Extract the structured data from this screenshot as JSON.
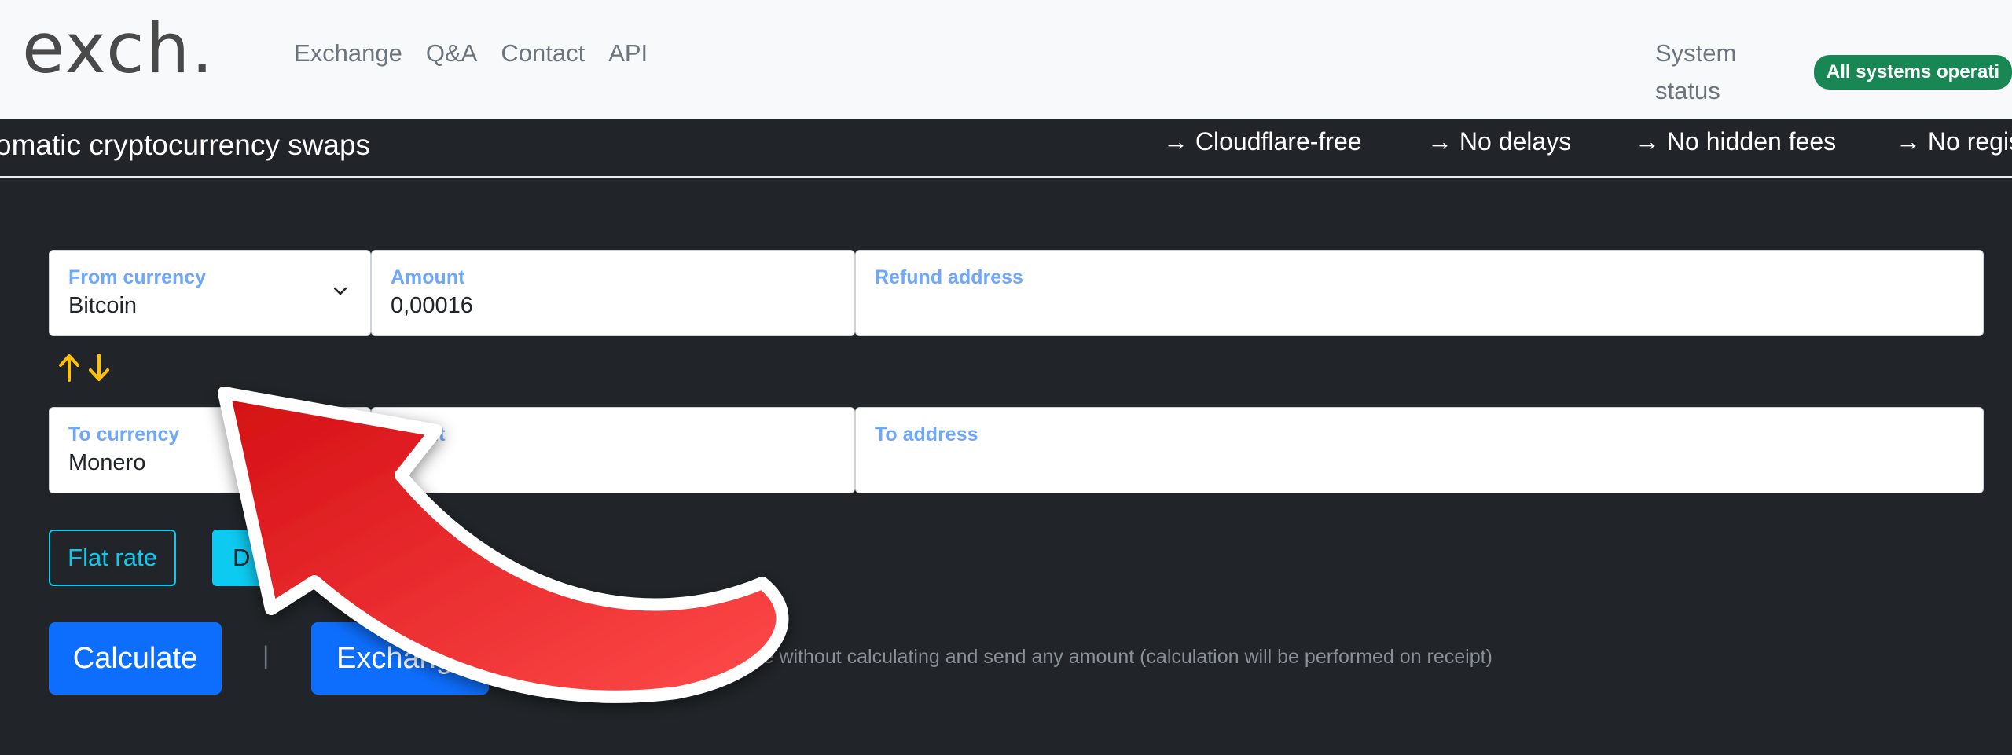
{
  "header": {
    "logo": {
      "text": "exch."
    },
    "nav": [
      "Exchange",
      "Q&A",
      "Contact",
      "API"
    ],
    "status_label": "System status",
    "status_badge": "All systems operati"
  },
  "ticker": {
    "slogan": "omatic cryptocurrency swaps",
    "features": [
      "→ Cloudflare-free",
      "→ No delays",
      "→ No hidden fees",
      "→ No regis"
    ]
  },
  "form": {
    "from_currency": {
      "label": "From currency",
      "value": "Bitcoin"
    },
    "amount": {
      "label": "Amount",
      "value": "0,00016"
    },
    "refund_address": {
      "label": "Refund address",
      "value": ""
    },
    "to_currency": {
      "label": "To currency",
      "value": "Monero"
    },
    "to_amount": {
      "label": "nt",
      "value": ""
    },
    "to_address": {
      "label": "To address",
      "value": ""
    },
    "flat_rate": "Flat rate",
    "dynamic_rate": "D",
    "calculate": "Calculate",
    "exchange": "Exchang",
    "separator": "|",
    "hint": "xchange without calculating and send any amount (calculation will be performed on receipt)"
  },
  "colors": {
    "accent": "#0d6efd",
    "info": "#0dcaf0",
    "success": "#198754",
    "swap_arrows": "#ffc107",
    "annotation_arrow": "#e51c23"
  },
  "icons": {
    "swap": "swap-arrows-icon",
    "dropdown": "chevron-down-icon",
    "annotation": "curved-arrow-annotation"
  }
}
